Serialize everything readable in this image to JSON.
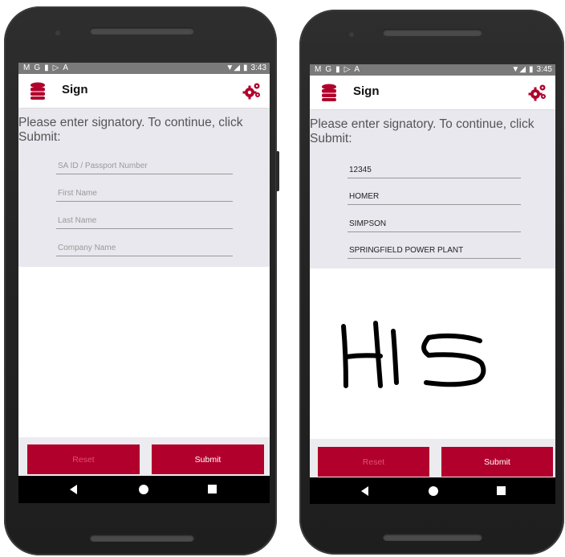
{
  "status": {
    "icons": [
      "M",
      "G",
      "▮",
      "▷",
      "A"
    ],
    "time_left": "3:43",
    "time_right": "3:45"
  },
  "appbar": {
    "title": "Sign",
    "db_icon": "database-icon",
    "settings_icon": "gears-icon"
  },
  "form": {
    "instruction": "Please enter signatory. To continue, click Submit:",
    "placeholders": {
      "id": "SA ID / Passport Number",
      "first_name": "First Name",
      "last_name": "Last Name",
      "company": "Company Name"
    },
    "values": {
      "id": "12345",
      "first_name": "HOMER",
      "last_name": "SIMPSON",
      "company": "SPRINGFIELD POWER PLANT"
    }
  },
  "buttons": {
    "reset": "Reset",
    "submit": "Submit"
  },
  "signature": {
    "text": "HS"
  },
  "colors": {
    "accent": "#b1002b",
    "form_bg": "#e8e8ee"
  }
}
